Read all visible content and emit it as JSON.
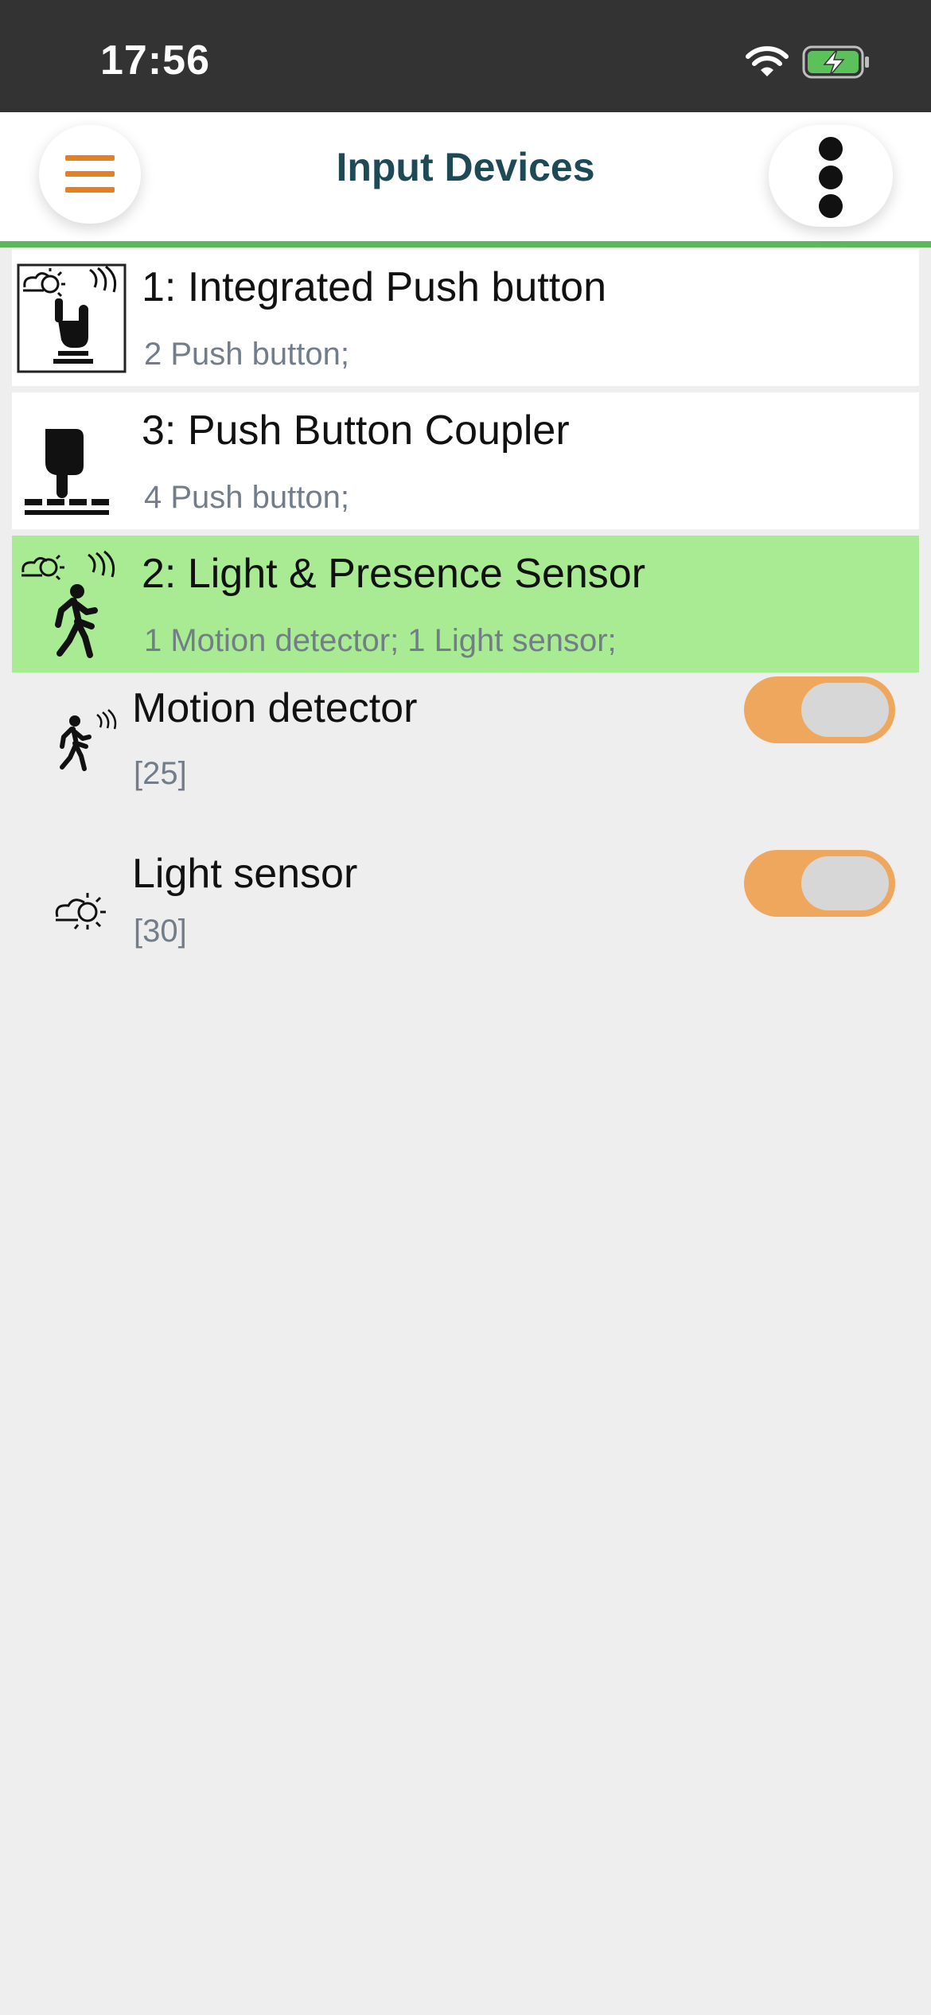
{
  "status_bar": {
    "time": "17:56",
    "icons": [
      "wifi-icon",
      "battery-charging-icon"
    ],
    "battery_color": "#5cc15a"
  },
  "header": {
    "title": "Input Devices",
    "menu_icon": "hamburger-menu-icon",
    "more_icon": "vertical-dots-icon",
    "accent_color": "#e67e22",
    "underline_color": "#5cb85c"
  },
  "devices": [
    {
      "title": "1: Integrated Push button",
      "subtitle": "2 Push button;",
      "icon": "integrated-push-button-icon",
      "selected": false
    },
    {
      "title": "3: Push Button Coupler",
      "subtitle": "4 Push button;",
      "icon": "push-button-coupler-icon",
      "selected": false
    },
    {
      "title": "2: Light & Presence Sensor",
      "subtitle": "1 Motion detector; 1 Light sensor;",
      "icon": "light-presence-sensor-icon",
      "selected": true
    }
  ],
  "channels": [
    {
      "title": "Motion detector",
      "id": "[25]",
      "icon": "motion-detector-icon",
      "toggle_color": "#eea75d"
    },
    {
      "title": "Light sensor",
      "id": "[30]",
      "icon": "light-sensor-icon",
      "toggle_color": "#eea75d"
    }
  ],
  "colors": {
    "selected_row": "#a8eb93",
    "background": "#eeeeee",
    "subtitle_text": "#737d89",
    "title_text": "#1e4a55"
  }
}
